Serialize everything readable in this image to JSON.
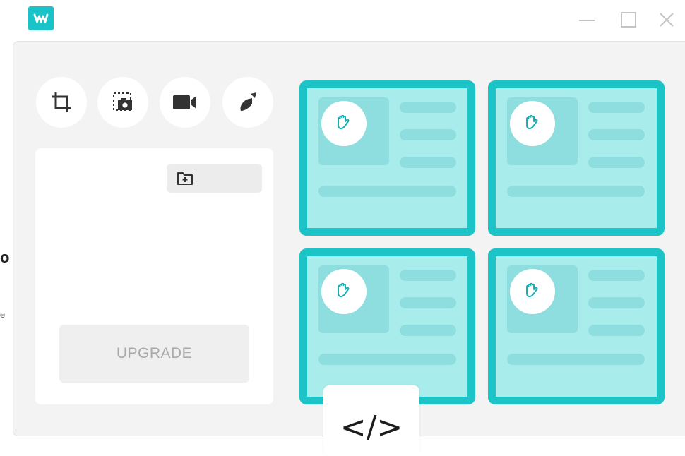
{
  "app": {
    "logo_letter": "w",
    "brand_color": "#19c3c7"
  },
  "window_controls": {
    "minimize": "minimize-icon",
    "maximize": "maximize-icon",
    "close": "close-icon"
  },
  "edge_text": {
    "line1": "o",
    "line2": "e"
  },
  "tools": [
    {
      "icon": "crop-icon"
    },
    {
      "icon": "screenshot-icon"
    },
    {
      "icon": "video-camera-icon"
    },
    {
      "icon": "brush-icon"
    }
  ],
  "left_card": {
    "upgrade_label": "UPGRADE"
  },
  "code_tab": {
    "label": "</>"
  },
  "colors": {
    "card_border": "#1cc4c8",
    "card_fill": "#a8ecec",
    "panel_bg": "#f3f3f3"
  }
}
